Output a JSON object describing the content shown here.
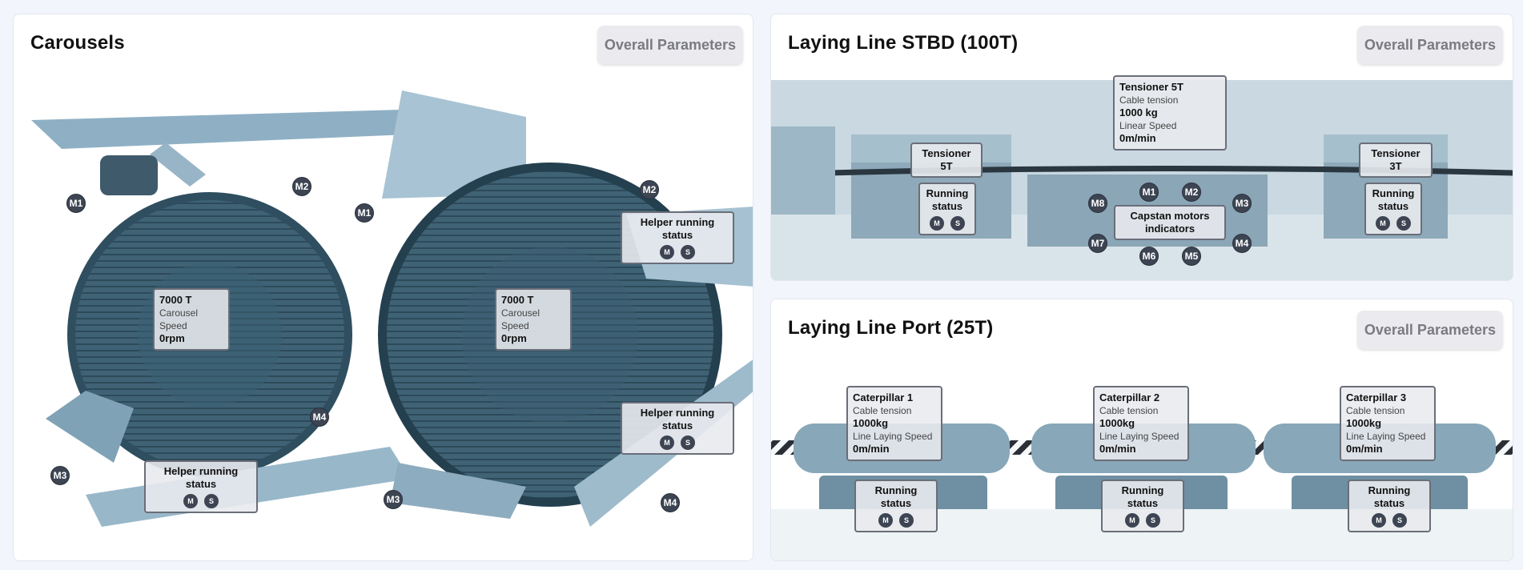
{
  "carousels": {
    "title": "Carousels",
    "overall_label": "Overall Parameters",
    "carousel_left": {
      "name": "7000 T",
      "param": "Carousel Speed",
      "value": "0rpm"
    },
    "carousel_right": {
      "name": "7000 T",
      "param": "Carousel Speed",
      "value": "0rpm"
    },
    "helper_status_top": "Helper running status",
    "helper_status_mid": "Helper running status",
    "helper_status_bottom": "Helper running status",
    "badges": [
      "M1",
      "M2",
      "M1",
      "M2",
      "M3",
      "M4",
      "M3",
      "M4"
    ],
    "m": "M",
    "s": "S"
  },
  "stbd": {
    "title": "Laying Line STBD (100T)",
    "overall_label": "Overall Parameters",
    "tensioner_top": {
      "name": "Tensioner 5T",
      "param1": "Cable tension",
      "value1": "1000 kg",
      "param2": "Linear Speed",
      "value2": "0m/min"
    },
    "tensioner_left_label": "Tensioner 5T",
    "tensioner_right_label": "Tensioner 3T",
    "running_status": "Running status",
    "capstan_label": "Capstan motors indicators",
    "capstan_badges": [
      "M1",
      "M2",
      "M3",
      "M4",
      "M5",
      "M6",
      "M7",
      "M8"
    ],
    "m": "M",
    "s": "S"
  },
  "port": {
    "title": "Laying Line Port (25T)",
    "overall_label": "Overall Parameters",
    "caterpillars": [
      {
        "name": "Caterpillar 1",
        "param1": "Cable tension",
        "value1": "1000kg",
        "param2": "Line Laying Speed",
        "value2": "0m/min"
      },
      {
        "name": "Caterpillar 2",
        "param1": "Cable tension",
        "value1": "1000kg",
        "param2": "Line Laying Speed",
        "value2": "0m/min"
      },
      {
        "name": "Caterpillar 3",
        "param1": "Cable tension",
        "value1": "1000kg",
        "param2": "Line Laying Speed",
        "value2": "0m/min"
      }
    ],
    "running_status": "Running status",
    "m": "M",
    "s": "S"
  }
}
